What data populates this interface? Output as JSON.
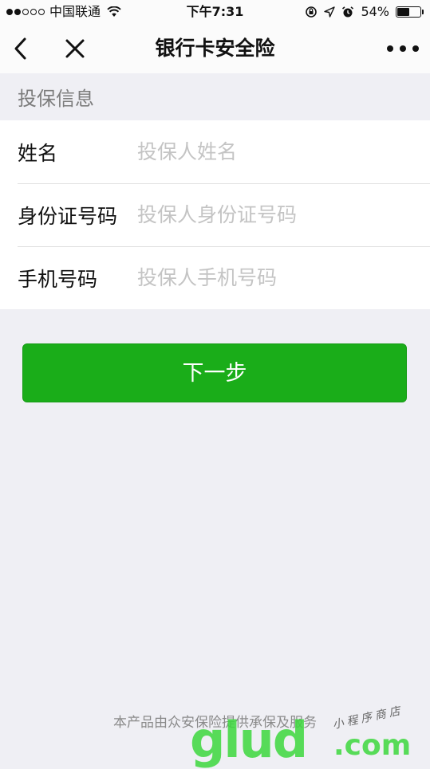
{
  "status_bar": {
    "carrier": "中国联通",
    "time": "下午7:31",
    "battery_percent_label": "54%",
    "battery_level": 0.54,
    "signal_bars_filled": 2,
    "signal_bars_total": 5
  },
  "nav": {
    "title": "银行卡安全险",
    "icons": [
      "chevron-left-icon",
      "close-icon",
      "more-icon"
    ]
  },
  "form": {
    "section_title": "投保信息",
    "fields": [
      {
        "label": "姓名",
        "placeholder": "投保人姓名",
        "value": ""
      },
      {
        "label": "身份证号码",
        "placeholder": "投保人身份证号码",
        "value": ""
      },
      {
        "label": "手机号码",
        "placeholder": "投保人手机号码",
        "value": ""
      }
    ]
  },
  "actions": {
    "next_label": "下一步",
    "button_color": "#1aad19"
  },
  "footer": {
    "text": "本产品由众安保险提供承保及服务"
  },
  "watermark": {
    "main": "glud",
    "domain": ".com",
    "script": "小程序商店"
  }
}
